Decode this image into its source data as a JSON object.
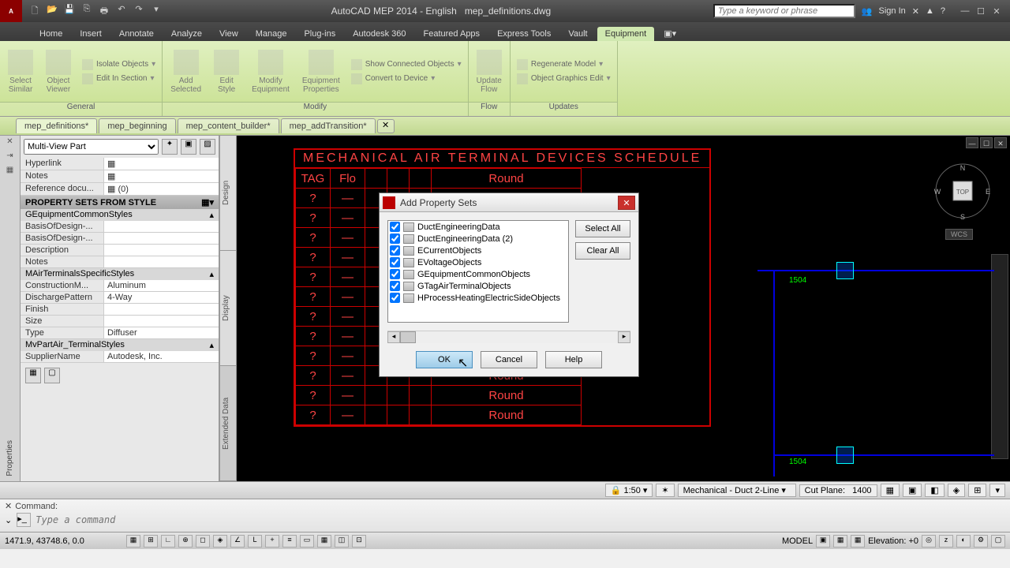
{
  "titlebar": {
    "app": "AutoCAD MEP 2014 - English",
    "doc": "mep_definitions.dwg",
    "search_placeholder": "Type a keyword or phrase",
    "signin": "Sign In"
  },
  "menutabs": [
    "Home",
    "Insert",
    "Annotate",
    "Analyze",
    "View",
    "Manage",
    "Plug-ins",
    "Autodesk 360",
    "Featured Apps",
    "Express Tools",
    "Vault",
    "Equipment"
  ],
  "menutabs_active": 11,
  "ribbon": {
    "panels": [
      {
        "label": "General",
        "big": [
          {
            "n": "select-similar",
            "t": "Select Similar"
          },
          {
            "n": "object-viewer",
            "t": "Object Viewer"
          }
        ],
        "small": [
          {
            "n": "isolate-objects",
            "t": "Isolate Objects"
          },
          {
            "n": "edit-in-section",
            "t": "Edit In Section"
          }
        ]
      },
      {
        "label": "Modify",
        "big": [
          {
            "n": "add-selected",
            "t": "Add Selected"
          },
          {
            "n": "edit-style",
            "t": "Edit Style"
          },
          {
            "n": "modify-equipment",
            "t": "Modify Equipment"
          },
          {
            "n": "equipment-properties",
            "t": "Equipment Properties"
          }
        ],
        "small": [
          {
            "n": "show-connected",
            "t": "Show Connected Objects"
          },
          {
            "n": "convert-device",
            "t": "Convert to Device"
          }
        ]
      },
      {
        "label": "Flow",
        "big": [
          {
            "n": "update-flow",
            "t": "Update Flow"
          }
        ],
        "small": []
      },
      {
        "label": "Updates",
        "big": [],
        "small": [
          {
            "n": "regenerate-model",
            "t": "Regenerate Model"
          },
          {
            "n": "object-graphics-edit",
            "t": "Object Graphics Edit"
          }
        ]
      }
    ]
  },
  "doctabs": [
    {
      "label": "mep_definitions*",
      "active": true
    },
    {
      "label": "mep_beginning",
      "active": false
    },
    {
      "label": "mep_content_builder*",
      "active": false
    },
    {
      "label": "mep_addTransition*",
      "active": false
    }
  ],
  "properties": {
    "dropdown": "Multi-View Part",
    "section_header": "PROPERTY SETS FROM STYLE",
    "top_rows": [
      {
        "k": "Hyperlink",
        "v": "",
        "icon": true
      },
      {
        "k": "Notes",
        "v": "",
        "icon": true
      },
      {
        "k": "Reference docu...",
        "v": "(0)",
        "icon": true
      }
    ],
    "groups": [
      {
        "name": "GEquipmentCommonStyles",
        "rows": [
          {
            "k": "BasisOfDesign-...",
            "v": ""
          },
          {
            "k": "BasisOfDesign-...",
            "v": ""
          },
          {
            "k": "Description",
            "v": ""
          },
          {
            "k": "Notes",
            "v": ""
          }
        ]
      },
      {
        "name": "MAirTerminalsSpecificStyles",
        "rows": [
          {
            "k": "ConstructionM...",
            "v": "Aluminum"
          },
          {
            "k": "DischargePattern",
            "v": "4-Way"
          },
          {
            "k": "Finish",
            "v": ""
          },
          {
            "k": "Size",
            "v": ""
          },
          {
            "k": "Type",
            "v": "Diffuser"
          }
        ]
      },
      {
        "name": "MvPartAir_TerminalStyles",
        "rows": [
          {
            "k": "SupplierName",
            "v": "Autodesk, Inc."
          }
        ]
      }
    ]
  },
  "sidetabs": [
    "Design",
    "Display",
    "Extended Data"
  ],
  "schedule": {
    "title": "MECHANICAL AIR TERMINAL DEVICES SCHEDULE",
    "headers": [
      "TAG",
      "Flo",
      "",
      "",
      "",
      "Round"
    ],
    "rows": 12,
    "col5": "Round"
  },
  "dialog": {
    "title": "Add Property Sets",
    "items": [
      "DuctEngineeringData",
      "DuctEngineeringData (2)",
      "ECurrentObjects",
      "EVoltageObjects",
      "GEquipmentCommonObjects",
      "GTagAirTerminalObjects",
      "HProcessHeatingElectricSideObjects"
    ],
    "select_all": "Select All",
    "clear_all": "Clear All",
    "ok": "OK",
    "cancel": "Cancel",
    "help": "Help"
  },
  "status1": {
    "scale": "1:50",
    "layer": "Mechanical - Duct 2-Line",
    "cutplane_label": "Cut Plane:",
    "cutplane": "1400"
  },
  "cmd": {
    "label": "Command:",
    "placeholder": "Type a command"
  },
  "status2": {
    "coords": "1471.9, 43748.6, 0.0",
    "model": "MODEL",
    "elevation_label": "Elevation:",
    "elevation": "+0"
  },
  "viewcube": {
    "wcs": "WCS",
    "n": "N",
    "s": "S",
    "e": "E",
    "w": "W",
    "top": "TOP",
    "dist": "1504"
  },
  "duct_label": "1504"
}
